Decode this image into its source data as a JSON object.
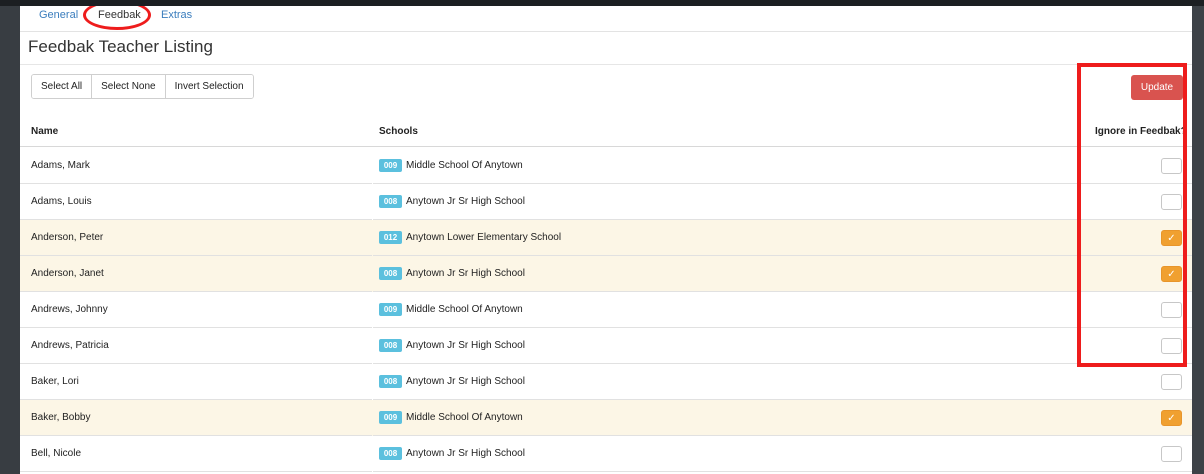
{
  "tabs": [
    {
      "label": "General"
    },
    {
      "label": "Feedbak"
    },
    {
      "label": "Extras"
    }
  ],
  "page_title": "Feedbak Teacher Listing",
  "toolbar": {
    "select_all": "Select All",
    "select_none": "Select None",
    "invert_selection": "Invert Selection",
    "update": "Update"
  },
  "table": {
    "headers": {
      "name": "Name",
      "schools": "Schools",
      "ignore": "Ignore in Feedbak?"
    },
    "rows": [
      {
        "name": "Adams, Mark",
        "code": "009",
        "school": "Middle School Of Anytown",
        "ignored": false
      },
      {
        "name": "Adams, Louis",
        "code": "008",
        "school": "Anytown Jr Sr High School",
        "ignored": false
      },
      {
        "name": "Anderson, Peter",
        "code": "012",
        "school": "Anytown Lower Elementary School",
        "ignored": true
      },
      {
        "name": "Anderson, Janet",
        "code": "008",
        "school": "Anytown Jr Sr High School",
        "ignored": true
      },
      {
        "name": "Andrews, Johnny",
        "code": "009",
        "school": "Middle School Of Anytown",
        "ignored": false
      },
      {
        "name": "Andrews, Patricia",
        "code": "008",
        "school": "Anytown Jr Sr High School",
        "ignored": false
      },
      {
        "name": "Baker, Lori",
        "code": "008",
        "school": "Anytown Jr Sr High School",
        "ignored": false
      },
      {
        "name": "Baker, Bobby",
        "code": "009",
        "school": "Middle School Of Anytown",
        "ignored": true
      },
      {
        "name": "Bell, Nicole",
        "code": "008",
        "school": "Anytown Jr Sr High School",
        "ignored": false
      }
    ]
  },
  "colors": {
    "update_button": "#d9534f",
    "checked_box": "#f0a030",
    "checked_row": "#fcf6e6",
    "school_badge": "#5bc0de",
    "annotation": "#ee1c1c"
  },
  "icons": {
    "checkbox_checked": "checkmark-icon"
  }
}
